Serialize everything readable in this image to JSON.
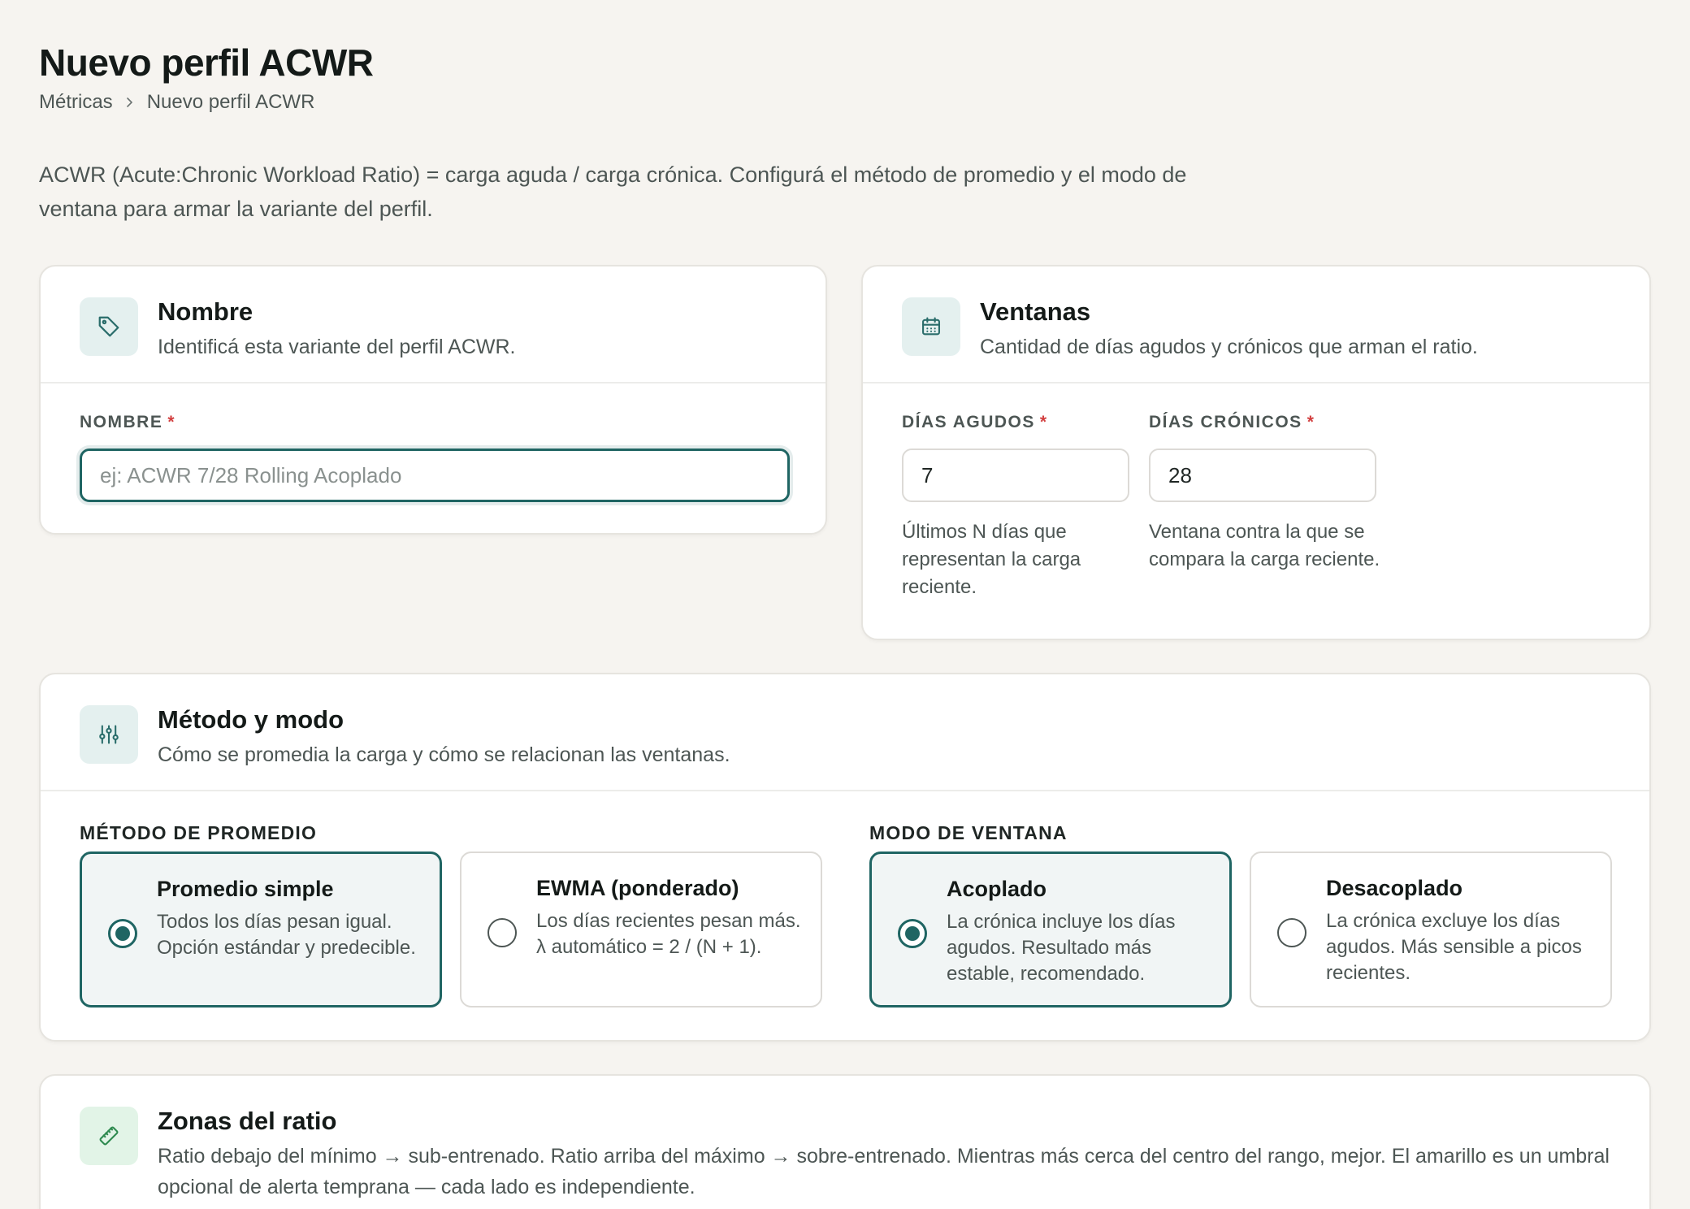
{
  "header": {
    "title": "Nuevo perfil ACWR",
    "breadcrumb": [
      "Métricas",
      "Nuevo perfil ACWR"
    ]
  },
  "intro": "ACWR (Acute:Chronic Workload Ratio) = carga aguda / carga crónica. Configurá el método de promedio y el modo de ventana para armar la variante del perfil.",
  "nombre_card": {
    "title": "Nombre",
    "subtitle": "Identificá esta variante del perfil ACWR.",
    "field_label": "NOMBRE",
    "required_mark": "*",
    "placeholder": "ej: ACWR 7/28 Rolling Acoplado",
    "value": ""
  },
  "ventanas_card": {
    "title": "Ventanas",
    "subtitle": "Cantidad de días agudos y crónicos que arman el ratio.",
    "agudos": {
      "label": "DÍAS AGUDOS",
      "value": "7",
      "help": "Últimos N días que representan la carga reciente."
    },
    "cronicos": {
      "label": "DÍAS CRÓNICOS",
      "value": "28",
      "help": "Ventana contra la que se compara la carga reciente."
    },
    "required_mark": "*"
  },
  "metodo_card": {
    "title": "Método y modo",
    "subtitle": "Cómo se promedia la carga y cómo se relacionan las ventanas.",
    "metodo": {
      "label": "MÉTODO DE PROMEDIO",
      "options": [
        {
          "title": "Promedio simple",
          "desc": "Todos los días pesan igual. Opción estándar y predecible.",
          "selected": true
        },
        {
          "title": "EWMA (ponderado)",
          "desc": "Los días recientes pesan más. λ automático = 2 / (N + 1).",
          "selected": false
        }
      ]
    },
    "modo": {
      "label": "MODO DE VENTANA",
      "options": [
        {
          "title": "Acoplado",
          "desc": "La crónica incluye los días agudos. Resultado más estable, recomendado.",
          "selected": true
        },
        {
          "title": "Desacoplado",
          "desc": "La crónica excluye los días agudos. Más sensible a picos recientes.",
          "selected": false
        }
      ]
    }
  },
  "zonas_card": {
    "title": "Zonas del ratio",
    "subtitle": "Ratio debajo del mínimo → sub-entrenado. Ratio arriba del máximo → sobre-entrenado. Mientras más cerca del centro del rango, mejor. El amarillo es un umbral opcional de alerta temprana — cada lado es independiente."
  },
  "icons": {
    "nombre": "tag-icon",
    "ventanas": "calendar-icon",
    "metodo": "sliders-icon",
    "zonas": "ruler-icon",
    "breadcrumb_sep": "chevron-right-icon"
  },
  "colors": {
    "accent": "#1f6563",
    "required": "#d23f3f",
    "background": "#f6f4f0"
  }
}
